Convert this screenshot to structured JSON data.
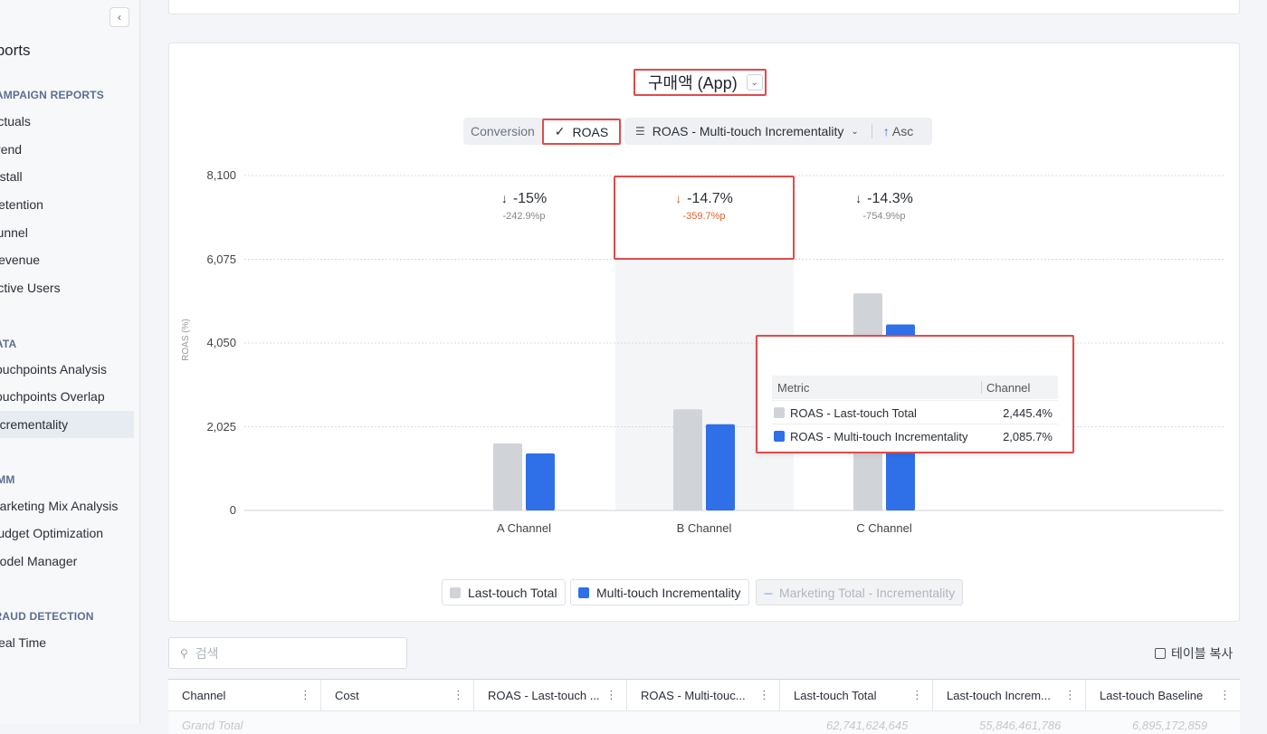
{
  "sidebar": {
    "collapse_icon": "chevron-left-icon",
    "title": "Reports",
    "sections": [
      {
        "label": "CAMPAIGN REPORTS",
        "top": 98
      },
      {
        "label": "DATA",
        "top": 373
      },
      {
        "label": "MMM",
        "top": 523
      },
      {
        "label": "FRAUD DETECTION",
        "top": 674
      }
    ],
    "items": [
      {
        "label": "Actuals",
        "top": 126
      },
      {
        "label": "Trend",
        "top": 157
      },
      {
        "label": "Install",
        "top": 187
      },
      {
        "label": "Retention",
        "top": 218
      },
      {
        "label": "Funnel",
        "top": 249
      },
      {
        "label": "Revenue",
        "top": 279
      },
      {
        "label": "Active Users",
        "top": 310
      },
      {
        "label": "Touchpoints Analysis",
        "top": 400
      },
      {
        "label": "Touchpoints Overlap",
        "top": 430
      },
      {
        "label": "Incrementality",
        "top": 461,
        "active": true
      },
      {
        "label": "Marketing Mix Analysis",
        "top": 551
      },
      {
        "label": "Budget Optimization",
        "top": 581
      },
      {
        "label": "Model Manager",
        "top": 612
      },
      {
        "label": "Real Time",
        "top": 702
      }
    ]
  },
  "metric_select": {
    "label": "구매액 (App)",
    "icon": "chevron-down-icon"
  },
  "toggle": {
    "conversion": "Conversion",
    "roas": "ROAS",
    "roas_icon": "check-icon"
  },
  "sort": {
    "label": "ROAS - Multi-touch Incrementality",
    "order": "Asc",
    "arrow": "↑"
  },
  "chart_data": {
    "type": "bar",
    "ylabel": "ROAS (%)",
    "yticks": [
      "8,100",
      "6,075",
      "4,050",
      "2,025",
      "0"
    ],
    "ylim": [
      0,
      8100
    ],
    "categories": [
      "A Channel",
      "B Channel",
      "C Channel"
    ],
    "series": [
      {
        "name": "Last-touch Total",
        "color": "#d0d3d8",
        "values": [
          1620,
          2445.4,
          5250
        ]
      },
      {
        "name": "Multi-touch Incrementality",
        "color": "#2f6fe8",
        "values": [
          1380,
          2085.7,
          4500
        ]
      }
    ],
    "deltas": [
      {
        "pct": "-15%",
        "pp": "-242.9%p"
      },
      {
        "pct": "-14.7%",
        "pp": "-359.7%p",
        "highlight": true
      },
      {
        "pct": "-14.3%",
        "pp": "-754.9%p"
      }
    ],
    "grid": true,
    "legend_position": "bottom-center"
  },
  "tooltip": {
    "col_metric": "Metric",
    "col_channel": "Channel",
    "rows": [
      {
        "name": "ROAS - Last-touch Total",
        "value": "2,445.4%",
        "color": "#d0d3d8"
      },
      {
        "name": "ROAS - Multi-touch Incrementality",
        "value": "2,085.7%",
        "color": "#2f6fe8"
      }
    ]
  },
  "legend": {
    "last_touch": "Last-touch Total",
    "multi_touch": "Multi-touch Incrementality",
    "marketing_total": "Marketing Total - Incrementality"
  },
  "search": {
    "placeholder": "검색"
  },
  "copy_table": "테이블 복사",
  "table": {
    "columns": [
      "Channel",
      "Cost",
      "ROAS - Last-touch ...",
      "ROAS - Multi-touc...",
      "Last-touch Total",
      "Last-touch Increm...",
      "Last-touch Baseline"
    ],
    "ghost_row": {
      "channel": "Grand Total",
      "c5": "62,741,624,645",
      "c6": "55,846,461,786",
      "c7": "6,895,172,859"
    }
  }
}
